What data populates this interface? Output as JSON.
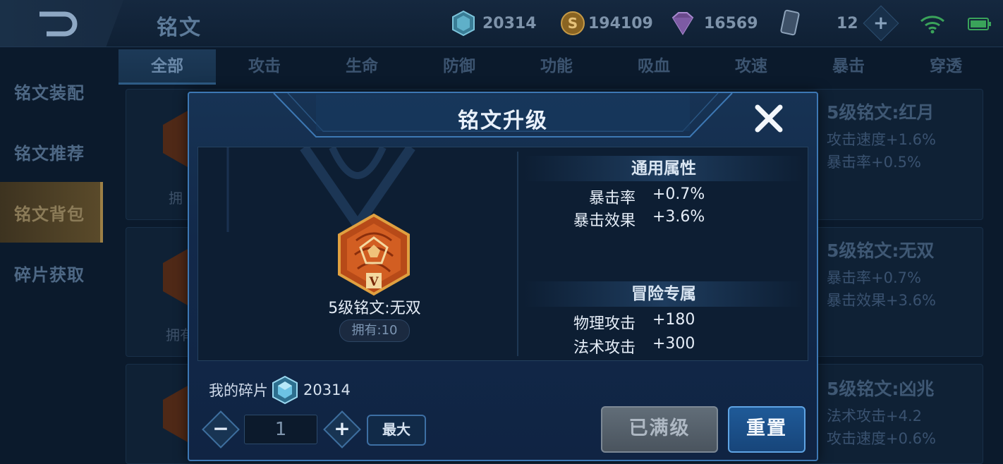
{
  "header": {
    "title": "铭文",
    "resources": [
      {
        "icon": "crystal-shard-icon",
        "value": "20314"
      },
      {
        "icon": "gold-coin-icon",
        "value": "194109"
      },
      {
        "icon": "purple-gem-icon",
        "value": "16569"
      },
      {
        "icon": "card-icon",
        "value": "12"
      }
    ]
  },
  "sidebar": {
    "items": [
      {
        "label": "铭文装配"
      },
      {
        "label": "铭文推荐"
      },
      {
        "label": "铭文背包"
      },
      {
        "label": "碎片获取"
      }
    ]
  },
  "tabs": [
    {
      "label": "全部"
    },
    {
      "label": "攻击"
    },
    {
      "label": "生命"
    },
    {
      "label": "防御"
    },
    {
      "label": "功能"
    },
    {
      "label": "吸血"
    },
    {
      "label": "攻速"
    },
    {
      "label": "暴击"
    },
    {
      "label": "穿透"
    }
  ],
  "background_list": {
    "own_partial_1": "拥",
    "own_partial_2": "拥有",
    "items": [
      {
        "name": "5级铭文:红月",
        "attrs": [
          "攻击速度+1.6%",
          "暴击率+0.5%"
        ]
      },
      {
        "name": "5级铭文:无双",
        "attrs": [
          "暴击率+0.7%",
          "暴击效果+3.6%"
        ]
      },
      {
        "name": "5级铭文:凶兆",
        "attrs": [
          "法术攻击+4.2",
          "攻击速度+0.6%"
        ]
      }
    ]
  },
  "dialog": {
    "title": "铭文升级",
    "rune": {
      "name": "5级铭文:无双",
      "owned": "拥有:10",
      "level_mark": "V"
    },
    "general_section": {
      "title": "通用属性",
      "rows": [
        {
          "key": "暴击率",
          "value": "+0.7%"
        },
        {
          "key": "暴击效果",
          "value": "+3.6%"
        }
      ]
    },
    "adventure_section": {
      "title": "冒险专属",
      "rows": [
        {
          "key": "物理攻击",
          "value": "+180"
        },
        {
          "key": "法术攻击",
          "value": "+300"
        }
      ]
    },
    "fragments": {
      "label": "我的碎片",
      "value": "20314"
    },
    "quantity": "1",
    "minus": "−",
    "plus": "+",
    "max_label": "最大",
    "maxed_label": "已满级",
    "reset_label": "重置"
  },
  "colors": {
    "accent_blue": "#3d78b4",
    "gold": "#9c7f45",
    "rune_orange": "#c95a1c"
  }
}
